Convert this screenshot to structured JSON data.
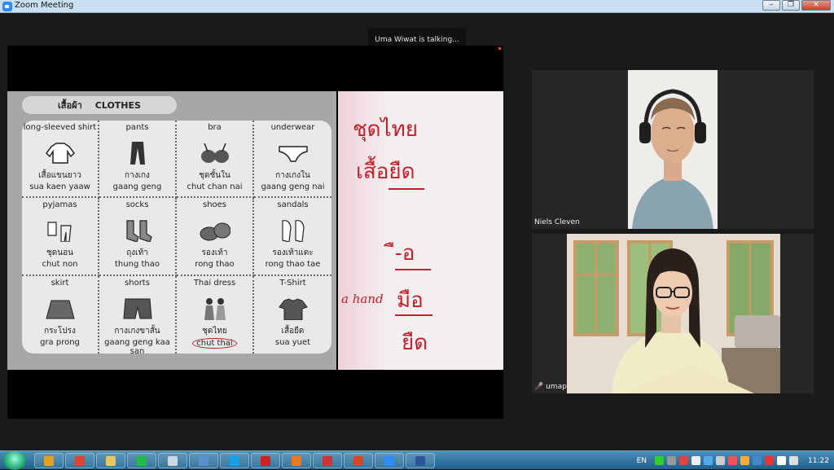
{
  "window": {
    "title": "Zoom Meeting",
    "minimize": "–",
    "restore": "❐",
    "close": "✕"
  },
  "talking_indicator": "Uma Wiwat is talking...",
  "worksheet": {
    "title_thai": "เสื้อผ้า",
    "title_en": "CLOTHES",
    "items": [
      {
        "en": "long-sleeved shirt",
        "th": "เสื้อแขนยาว",
        "rom": "sua kaen yaaw",
        "icon": "long-sleeved-shirt-icon"
      },
      {
        "en": "pants",
        "th": "กางเกง",
        "rom": "gaang geng",
        "icon": "pants-icon"
      },
      {
        "en": "bra",
        "th": "ชุดชั้นใน",
        "rom": "chut chan nai",
        "icon": "bra-icon"
      },
      {
        "en": "underwear",
        "th": "กางเกงใน",
        "rom": "gaang geng nai",
        "icon": "underwear-icon"
      },
      {
        "en": "pyjamas",
        "th": "ชุดนอน",
        "rom": "chut non",
        "icon": "pyjamas-icon"
      },
      {
        "en": "socks",
        "th": "ถุงเท้า",
        "rom": "thung thao",
        "icon": "socks-icon"
      },
      {
        "en": "shoes",
        "th": "รองเท้า",
        "rom": "rong thao",
        "icon": "shoes-icon"
      },
      {
        "en": "sandals",
        "th": "รองเท้าแตะ",
        "rom": "rong thao tae",
        "icon": "sandals-icon"
      },
      {
        "en": "skirt",
        "th": "กระโปรง",
        "rom": "gra prong",
        "icon": "skirt-icon"
      },
      {
        "en": "shorts",
        "th": "กางเกงขาสั้น",
        "rom": "gaang geng kaa san",
        "icon": "shorts-icon"
      },
      {
        "en": "Thai dress",
        "th": "ชุดไทย",
        "rom": "chut thai",
        "icon": "thai-dress-icon"
      },
      {
        "en": "T-Shirt",
        "th": "เสื้อยืด",
        "rom": "sua yuet",
        "icon": "t-shirt-icon"
      }
    ]
  },
  "whiteboard": {
    "line1": "ชุดไทย",
    "line2": "เสื้อยืด",
    "line3": "ื-อ",
    "hand_label": "a hand",
    "line4": "มือ",
    "line5": "ยืด"
  },
  "participants": [
    {
      "name": "Niels Cleven"
    },
    {
      "name": "umap"
    }
  ],
  "taskbar": {
    "language": "EN",
    "clock": "11:22",
    "apps": [
      {
        "name": "media-player",
        "color": "#e8a020"
      },
      {
        "name": "chrome",
        "color": "#dd4433"
      },
      {
        "name": "file-explorer",
        "color": "#e8c860"
      },
      {
        "name": "line",
        "color": "#22bb44"
      },
      {
        "name": "notepad",
        "color": "#cfd8e0"
      },
      {
        "name": "calculator",
        "color": "#5a8fd0"
      },
      {
        "name": "skype",
        "color": "#1aa0e8"
      },
      {
        "name": "acrobat",
        "color": "#cc2222"
      },
      {
        "name": "firefox",
        "color": "#ee7722"
      },
      {
        "name": "screen-recorder",
        "color": "#cc3333"
      },
      {
        "name": "powerpoint",
        "color": "#d24726"
      },
      {
        "name": "zoom",
        "color": "#2d8cff"
      },
      {
        "name": "word",
        "color": "#2b579a"
      }
    ]
  }
}
